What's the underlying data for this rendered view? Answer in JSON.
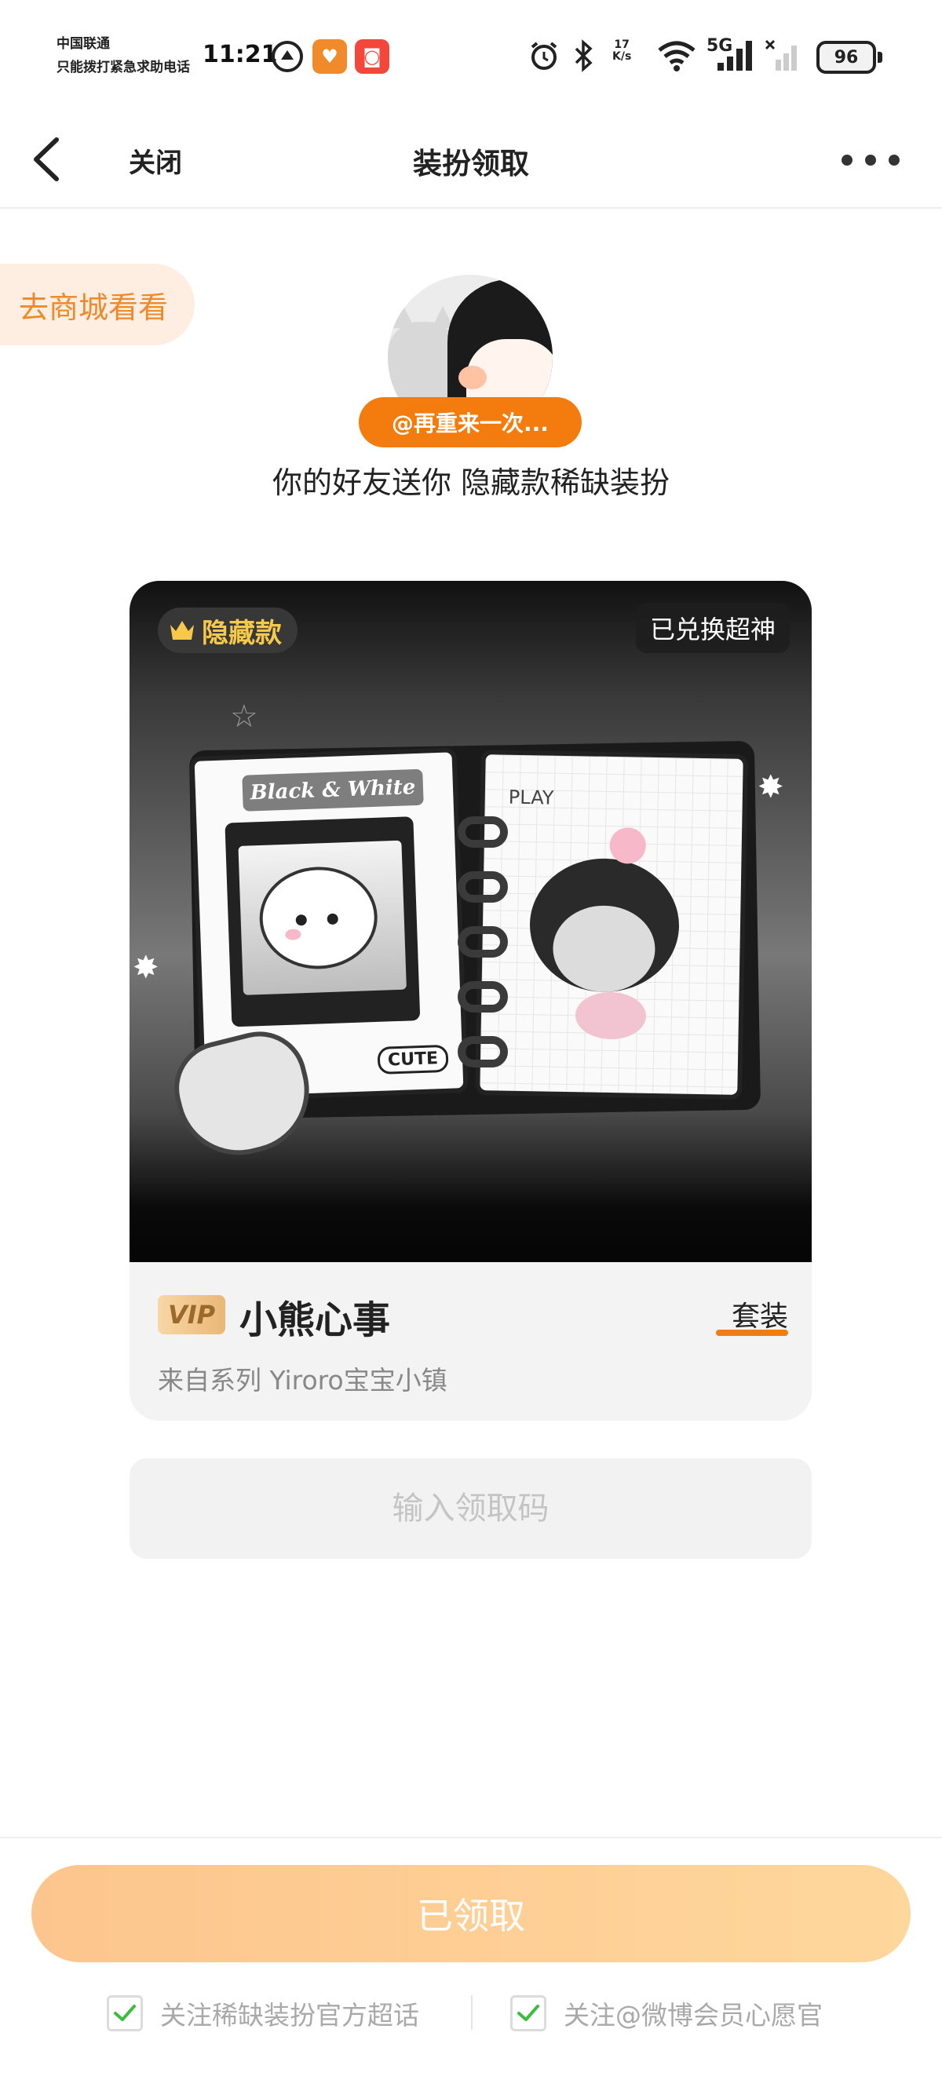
{
  "status_bar": {
    "carrier": "中国联通",
    "emergency": "只能拨打紧急求助电话",
    "time": "11:21",
    "net_speed_value": "17",
    "net_speed_unit": "K/s",
    "network_label": "5G",
    "battery": "96"
  },
  "nav": {
    "close_label": "关闭",
    "title": "装扮领取"
  },
  "shop_link": "去商城看看",
  "gift": {
    "sender": "@再重来一次...",
    "message": "你的好友送你 隐藏款稀缺装扮"
  },
  "card": {
    "badge": "隐藏款",
    "status_tag": "已兑换超神",
    "illustration_title": "Black & White",
    "illustration_play": "PLAY",
    "illustration_cute": "CUTE",
    "vip_label": "VIP",
    "item_name": "小熊心事",
    "item_type": "套装",
    "series": "来自系列  Yiroro宝宝小镇"
  },
  "code_input": {
    "placeholder": "输入领取码"
  },
  "claim_button": "已领取",
  "follow_options": [
    {
      "label": "关注稀缺装扮官方超话",
      "checked": true
    },
    {
      "label": "关注@微博会员心愿官",
      "checked": true
    }
  ],
  "colors": {
    "accent_orange": "#f47c0e",
    "check_green": "#3dbd3f",
    "gold": "#f6c94a"
  }
}
